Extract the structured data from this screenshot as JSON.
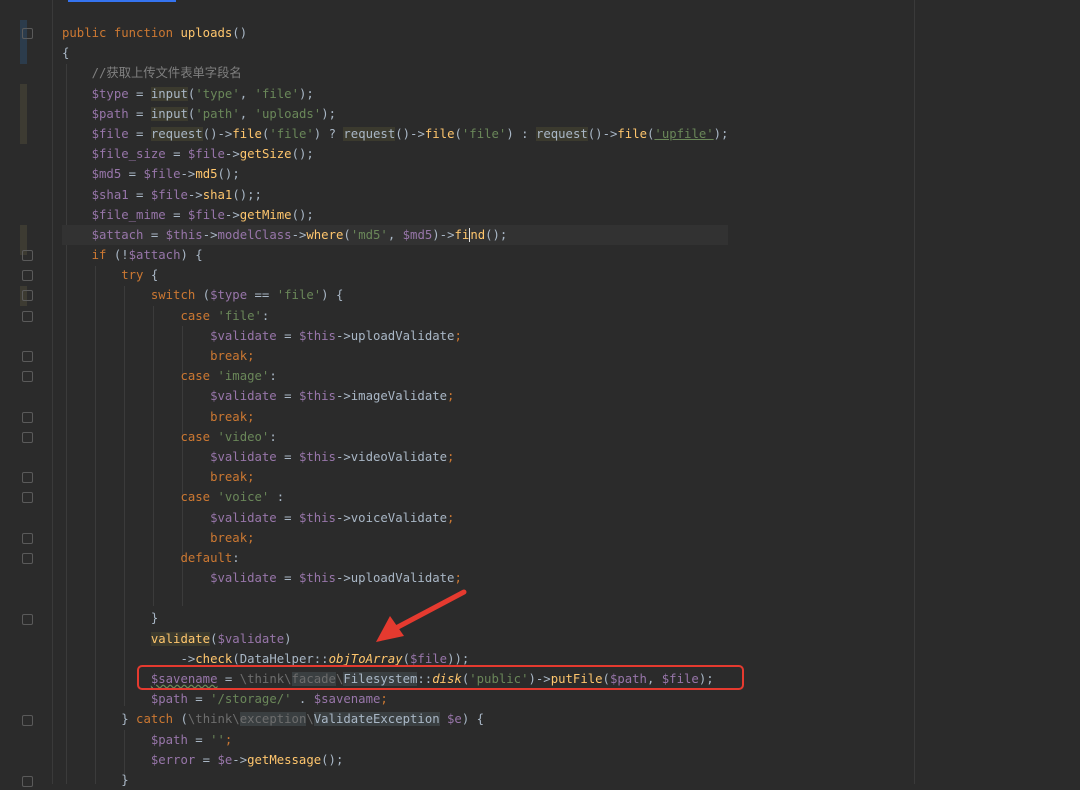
{
  "code": {
    "l1": {
      "kw1": "public",
      "kw2": "function",
      "name": "uploads",
      "rest": "()"
    },
    "l2": {
      "text": "{"
    },
    "l3": {
      "comment": "//获取上传文件表单字段名"
    },
    "l4": {
      "var": "$type",
      "eq": " = ",
      "fn": "input",
      "a": "(",
      "s1": "'type'",
      "c": ", ",
      "s2": "'file'",
      "e": ");"
    },
    "l5": {
      "var": "$path",
      "eq": " = ",
      "fn": "input",
      "a": "(",
      "s1": "'path'",
      "c": ", ",
      "s2": "'uploads'",
      "e": ");"
    },
    "l6": {
      "var": "$file",
      "eq": " = ",
      "fn1": "request",
      "t1": "()->",
      "m1": "file",
      "a1": "(",
      "s1": "'file'",
      "b1": ") ? ",
      "fn2": "request",
      "t2": "()->",
      "m2": "file",
      "a2": "(",
      "s2": "'file'",
      "b2": ") : ",
      "fn3": "request",
      "t3": "()->",
      "m3": "file",
      "a3": "(",
      "s3": "'upfile'",
      "e": ");"
    },
    "l7": {
      "var": "$file_size",
      "eq": " = ",
      "v2": "$file",
      "arr": "->",
      "m": "getSize",
      "e": "();"
    },
    "l8": {
      "var": "$md5",
      "eq": " = ",
      "v2": "$file",
      "arr": "->",
      "m": "md5",
      "e": "();"
    },
    "l9": {
      "var": "$sha1",
      "eq": " = ",
      "v2": "$file",
      "arr": "->",
      "m": "sha1",
      "e": "();;"
    },
    "l10": {
      "var": "$file_mime",
      "eq": " = ",
      "v2": "$file",
      "arr": "->",
      "m": "getMime",
      "e": "();"
    },
    "l11": {
      "var": "$attach",
      "eq": " = ",
      "v2": "$this",
      "arr": "->",
      "p": "modelClass",
      "arr2": "->",
      "m": "where",
      "a": "(",
      "s": "'md5'",
      "c": ", ",
      "v3": "$md5",
      "b": ")->",
      "m2a": "fi",
      "m2b": "nd",
      "e": "();"
    },
    "l12": {
      "kw": "if",
      "a": " (!",
      "var": "$attach",
      "e": ") {"
    },
    "l13": {
      "kw": "try",
      "e": " {"
    },
    "l14": {
      "kw": "switch",
      "a": " (",
      "var": "$type",
      "b": " == ",
      "s": "'file'",
      "e": ") {"
    },
    "l15": {
      "kw": "case",
      "sp": " ",
      "s": "'file'",
      "e": ":"
    },
    "l16": {
      "var": "$validate",
      "eq": " = ",
      "v2": "$this",
      "arr": "->",
      "p": "uploadValidate",
      "e": ";"
    },
    "l17": {
      "kw": "break",
      "e": ";"
    },
    "l18": {
      "kw": "case",
      "sp": " ",
      "s": "'image'",
      "e": ":"
    },
    "l19": {
      "var": "$validate",
      "eq": " = ",
      "v2": "$this",
      "arr": "->",
      "p": "imageValidate",
      "e": ";"
    },
    "l20": {
      "kw": "break",
      "e": ";"
    },
    "l21": {
      "kw": "case",
      "sp": " ",
      "s": "'video'",
      "e": ":"
    },
    "l22": {
      "var": "$validate",
      "eq": " = ",
      "v2": "$this",
      "arr": "->",
      "p": "videoValidate",
      "e": ";"
    },
    "l23": {
      "kw": "break",
      "e": ";"
    },
    "l24": {
      "kw": "case",
      "sp": " ",
      "s": "'voice'",
      "e": " :"
    },
    "l25": {
      "var": "$validate",
      "eq": " = ",
      "v2": "$this",
      "arr": "->",
      "p": "voiceValidate",
      "e": ";"
    },
    "l26": {
      "kw": "break",
      "e": ";"
    },
    "l27": {
      "kw": "default",
      "e": ":"
    },
    "l28": {
      "var": "$validate",
      "eq": " = ",
      "v2": "$this",
      "arr": "->",
      "p": "uploadValidate",
      "e": ";"
    },
    "l30": {
      "text": "}"
    },
    "l31": {
      "fn": "validate",
      "a": "(",
      "var": "$validate",
      "e": ")"
    },
    "l32": {
      "arr": "->",
      "m": "check",
      "a": "(",
      "cls": "DataHelper",
      "dc": "::",
      "sm": "objToArray",
      "b": "(",
      "var": "$file",
      "e": "));"
    },
    "l33": {
      "var": "$savename",
      "eq": " = ",
      "ns1": "\\think\\",
      "ns2": "facade",
      "ns3": "\\",
      "cls": "Filesystem",
      "dc": "::",
      "sm": "disk",
      "a": "(",
      "s": "'public'",
      "b": ")->",
      "m": "putFile",
      "c": "(",
      "v2": "$path",
      "d": ", ",
      "v3": "$file",
      "e": ");"
    },
    "l34": {
      "var": "$path",
      "eq": " = ",
      "s": "'/storage/'",
      "d": " . ",
      "v2": "$savename",
      "e": ";"
    },
    "l35": {
      "a": "} ",
      "kw": "catch",
      "b": " (",
      "ns1": "\\think\\",
      "ns2": "exception",
      "ns3": "\\",
      "cls": "ValidateException",
      "sp": " ",
      "var": "$e",
      "e": ") {"
    },
    "l36": {
      "var": "$path",
      "eq": " = ",
      "s": "''",
      "e": ";"
    },
    "l37": {
      "var": "$error",
      "eq": " = ",
      "v2": "$e",
      "arr": "->",
      "m": "getMessage",
      "e": "();"
    },
    "l38": {
      "text": "}"
    }
  },
  "colors": {
    "keyword": "#cc7832",
    "function": "#ffc66d",
    "variable": "#9876aa",
    "string": "#6a8759",
    "comment": "#808080",
    "text": "#a9b7c6",
    "background": "#2b2b2b",
    "highlight_box": "#e53a2f"
  },
  "icons": {
    "fold": "fold-marker-icon",
    "arrow": "red-arrow-annotation-icon"
  }
}
